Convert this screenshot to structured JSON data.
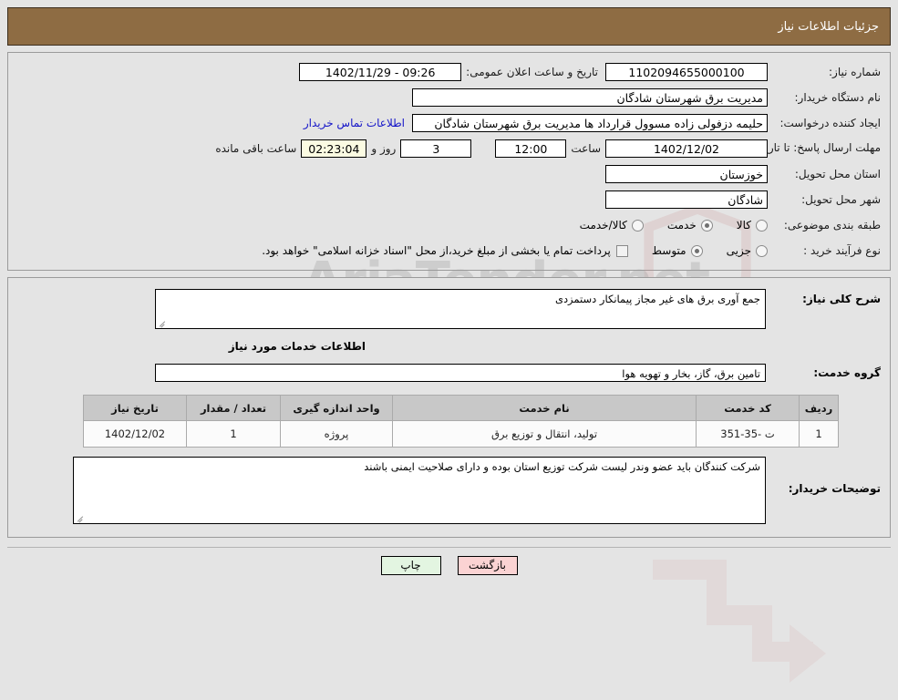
{
  "header": {
    "title": "جزئیات اطلاعات نیاز"
  },
  "form": {
    "need_number_label": "شماره نیاز:",
    "need_number": "1102094655000100",
    "public_announce_label": "تاریخ و ساعت اعلان عمومی:",
    "public_announce_value": "09:26 - 1402/11/29",
    "buyer_org_label": "نام دستگاه خریدار:",
    "buyer_org": "مدیریت برق شهرستان شادگان",
    "creator_label": "ایجاد کننده درخواست:",
    "creator": "حلیمه دزفولی زاده مسوول قرارداد ها مدیریت برق شهرستان شادگان",
    "contact_link": "اطلاعات تماس خریدار",
    "deadline_label": "مهلت ارسال پاسخ: تا تاریخ:",
    "deadline_date": "1402/12/02",
    "hour_label": "ساعت",
    "deadline_time": "12:00",
    "days_value": "3",
    "days_label": "روز و",
    "countdown": "02:23:04",
    "remaining_label": "ساعت باقی مانده",
    "province_label": "استان محل تحویل:",
    "province": "خوزستان",
    "city_label": "شهر محل تحویل:",
    "city": "شادگان",
    "category_label": "طبقه بندی موضوعی:",
    "category_options": [
      {
        "label": "کالا",
        "selected": false
      },
      {
        "label": "خدمت",
        "selected": true
      },
      {
        "label": "کالا/خدمت",
        "selected": false
      }
    ],
    "process_label": "نوع فرآیند خرید :",
    "process_options": [
      {
        "label": "جزیی",
        "selected": false
      },
      {
        "label": "متوسط",
        "selected": true
      }
    ],
    "treasury_checkbox_label": "پرداخت تمام یا بخشی از مبلغ خرید،از محل \"اسناد خزانه اسلامی\" خواهد بود.",
    "treasury_checked": false
  },
  "details": {
    "need_desc_label": "شرح کلی نیاز:",
    "need_desc": "جمع آوری برق های غیر مجاز پیمانکار دستمزدی",
    "services_section_title": "اطلاعات خدمات مورد نیاز",
    "service_group_label": "گروه خدمت:",
    "service_group": "تامین برق، گاز، بخار و تهویه هوا",
    "buyer_notes_label": "توضیحات خریدار:",
    "buyer_notes": "شرکت کنندگان باید عضو وندر لیست شرکت توزیع استان بوده و دارای صلاحیت ایمنی باشند"
  },
  "table": {
    "columns": [
      "ردیف",
      "کد خدمت",
      "نام خدمت",
      "واحد اندازه گیری",
      "تعداد / مقدار",
      "تاریخ نیاز"
    ],
    "rows": [
      {
        "radif": "1",
        "code": "ت -35-351",
        "name": "تولید، انتقال و توزیع برق",
        "unit": "پروژه",
        "qty": "1",
        "date": "1402/12/02"
      }
    ]
  },
  "footer": {
    "back_label": "بازگشت",
    "print_label": "چاپ"
  },
  "watermark": {
    "text": "AriaTender.net"
  },
  "colors": {
    "header_bar": "#8e6c43",
    "page_bg": "#e4e4e4",
    "link": "#1414c8",
    "timer_bg": "#fbfbe2",
    "back_btn": "#fbd3d3",
    "print_btn": "#e3f5e1",
    "table_header": "#c8c8c8"
  }
}
